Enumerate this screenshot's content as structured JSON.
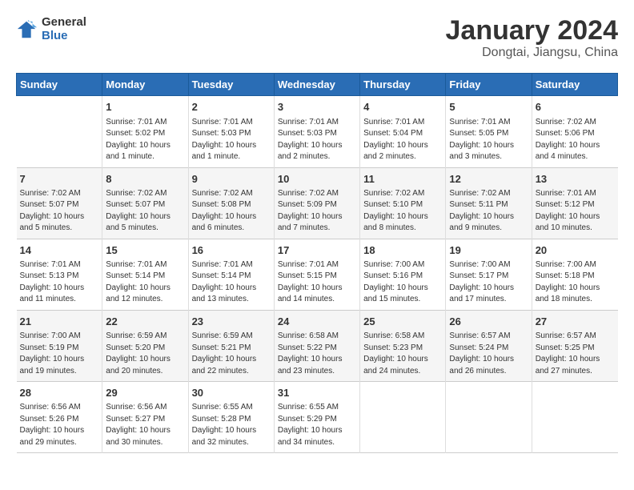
{
  "header": {
    "logo": {
      "general": "General",
      "blue": "Blue"
    },
    "title": "January 2024",
    "location": "Dongtai, Jiangsu, China"
  },
  "days": [
    "Sunday",
    "Monday",
    "Tuesday",
    "Wednesday",
    "Thursday",
    "Friday",
    "Saturday"
  ],
  "weeks": [
    [
      {
        "date": "",
        "info": ""
      },
      {
        "date": "1",
        "info": "Sunrise: 7:01 AM\nSunset: 5:02 PM\nDaylight: 10 hours\nand 1 minute."
      },
      {
        "date": "2",
        "info": "Sunrise: 7:01 AM\nSunset: 5:03 PM\nDaylight: 10 hours\nand 1 minute."
      },
      {
        "date": "3",
        "info": "Sunrise: 7:01 AM\nSunset: 5:03 PM\nDaylight: 10 hours\nand 2 minutes."
      },
      {
        "date": "4",
        "info": "Sunrise: 7:01 AM\nSunset: 5:04 PM\nDaylight: 10 hours\nand 2 minutes."
      },
      {
        "date": "5",
        "info": "Sunrise: 7:01 AM\nSunset: 5:05 PM\nDaylight: 10 hours\nand 3 minutes."
      },
      {
        "date": "6",
        "info": "Sunrise: 7:02 AM\nSunset: 5:06 PM\nDaylight: 10 hours\nand 4 minutes."
      }
    ],
    [
      {
        "date": "7",
        "info": "Sunrise: 7:02 AM\nSunset: 5:07 PM\nDaylight: 10 hours\nand 5 minutes."
      },
      {
        "date": "8",
        "info": "Sunrise: 7:02 AM\nSunset: 5:07 PM\nDaylight: 10 hours\nand 5 minutes."
      },
      {
        "date": "9",
        "info": "Sunrise: 7:02 AM\nSunset: 5:08 PM\nDaylight: 10 hours\nand 6 minutes."
      },
      {
        "date": "10",
        "info": "Sunrise: 7:02 AM\nSunset: 5:09 PM\nDaylight: 10 hours\nand 7 minutes."
      },
      {
        "date": "11",
        "info": "Sunrise: 7:02 AM\nSunset: 5:10 PM\nDaylight: 10 hours\nand 8 minutes."
      },
      {
        "date": "12",
        "info": "Sunrise: 7:02 AM\nSunset: 5:11 PM\nDaylight: 10 hours\nand 9 minutes."
      },
      {
        "date": "13",
        "info": "Sunrise: 7:01 AM\nSunset: 5:12 PM\nDaylight: 10 hours\nand 10 minutes."
      }
    ],
    [
      {
        "date": "14",
        "info": "Sunrise: 7:01 AM\nSunset: 5:13 PM\nDaylight: 10 hours\nand 11 minutes."
      },
      {
        "date": "15",
        "info": "Sunrise: 7:01 AM\nSunset: 5:14 PM\nDaylight: 10 hours\nand 12 minutes."
      },
      {
        "date": "16",
        "info": "Sunrise: 7:01 AM\nSunset: 5:14 PM\nDaylight: 10 hours\nand 13 minutes."
      },
      {
        "date": "17",
        "info": "Sunrise: 7:01 AM\nSunset: 5:15 PM\nDaylight: 10 hours\nand 14 minutes."
      },
      {
        "date": "18",
        "info": "Sunrise: 7:00 AM\nSunset: 5:16 PM\nDaylight: 10 hours\nand 15 minutes."
      },
      {
        "date": "19",
        "info": "Sunrise: 7:00 AM\nSunset: 5:17 PM\nDaylight: 10 hours\nand 17 minutes."
      },
      {
        "date": "20",
        "info": "Sunrise: 7:00 AM\nSunset: 5:18 PM\nDaylight: 10 hours\nand 18 minutes."
      }
    ],
    [
      {
        "date": "21",
        "info": "Sunrise: 7:00 AM\nSunset: 5:19 PM\nDaylight: 10 hours\nand 19 minutes."
      },
      {
        "date": "22",
        "info": "Sunrise: 6:59 AM\nSunset: 5:20 PM\nDaylight: 10 hours\nand 20 minutes."
      },
      {
        "date": "23",
        "info": "Sunrise: 6:59 AM\nSunset: 5:21 PM\nDaylight: 10 hours\nand 22 minutes."
      },
      {
        "date": "24",
        "info": "Sunrise: 6:58 AM\nSunset: 5:22 PM\nDaylight: 10 hours\nand 23 minutes."
      },
      {
        "date": "25",
        "info": "Sunrise: 6:58 AM\nSunset: 5:23 PM\nDaylight: 10 hours\nand 24 minutes."
      },
      {
        "date": "26",
        "info": "Sunrise: 6:57 AM\nSunset: 5:24 PM\nDaylight: 10 hours\nand 26 minutes."
      },
      {
        "date": "27",
        "info": "Sunrise: 6:57 AM\nSunset: 5:25 PM\nDaylight: 10 hours\nand 27 minutes."
      }
    ],
    [
      {
        "date": "28",
        "info": "Sunrise: 6:56 AM\nSunset: 5:26 PM\nDaylight: 10 hours\nand 29 minutes."
      },
      {
        "date": "29",
        "info": "Sunrise: 6:56 AM\nSunset: 5:27 PM\nDaylight: 10 hours\nand 30 minutes."
      },
      {
        "date": "30",
        "info": "Sunrise: 6:55 AM\nSunset: 5:28 PM\nDaylight: 10 hours\nand 32 minutes."
      },
      {
        "date": "31",
        "info": "Sunrise: 6:55 AM\nSunset: 5:29 PM\nDaylight: 10 hours\nand 34 minutes."
      },
      {
        "date": "",
        "info": ""
      },
      {
        "date": "",
        "info": ""
      },
      {
        "date": "",
        "info": ""
      }
    ]
  ]
}
